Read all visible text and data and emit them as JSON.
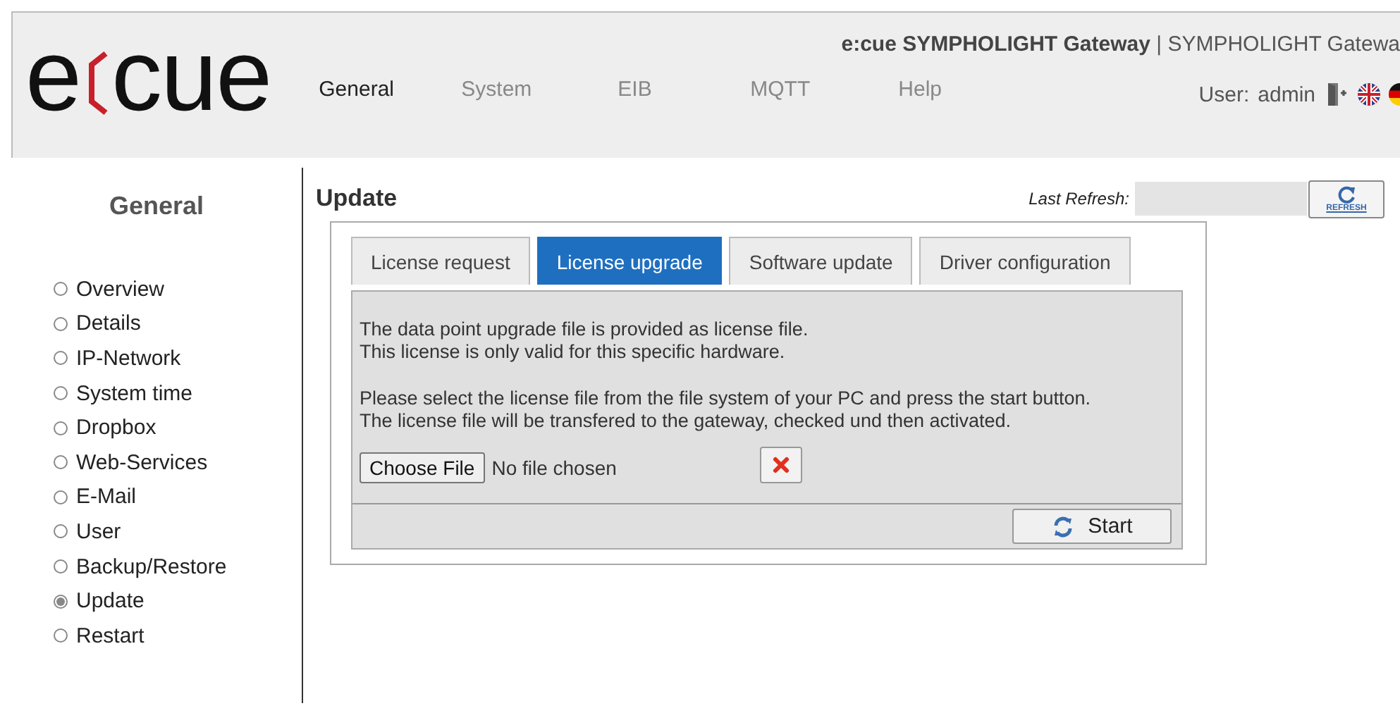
{
  "header": {
    "logo_left": "e",
    "logo_right": "cue",
    "product_bold": "e:cue SYMPHOLIGHT Gateway",
    "product_separator": "|",
    "product_name": "SYMPHOLIGHT Gatewa",
    "nav": [
      {
        "label": "General",
        "selected": true
      },
      {
        "label": "System",
        "selected": false
      },
      {
        "label": "EIB",
        "selected": false
      },
      {
        "label": "MQTT",
        "selected": false
      },
      {
        "label": "Help",
        "selected": false
      }
    ],
    "user_label": "User:",
    "user_name": "admin"
  },
  "sidebar": {
    "title": "General",
    "items": [
      {
        "label": "Overview",
        "selected": false
      },
      {
        "label": "Details",
        "selected": false
      },
      {
        "label": "IP-Network",
        "selected": false
      },
      {
        "label": "System time",
        "selected": false
      },
      {
        "label": "Dropbox",
        "selected": false
      },
      {
        "label": "Web-Services",
        "selected": false
      },
      {
        "label": "E-Mail",
        "selected": false
      },
      {
        "label": "User",
        "selected": false
      },
      {
        "label": "Backup/Restore",
        "selected": false
      },
      {
        "label": "Update",
        "selected": true
      },
      {
        "label": "Restart",
        "selected": false
      }
    ]
  },
  "main": {
    "title": "Update",
    "last_refresh_label": "Last Refresh:",
    "refresh_button": "REFRESH",
    "tabs": [
      {
        "label": "License request",
        "selected": false
      },
      {
        "label": "License upgrade",
        "selected": true
      },
      {
        "label": "Software update",
        "selected": false
      },
      {
        "label": "Driver configuration",
        "selected": false
      }
    ],
    "paragraphs": [
      [
        "The data point upgrade file is provided as license file.",
        "This license is only valid for this specific hardware."
      ],
      [
        "Please select the license file from the file system of your PC and press the start button.",
        "The license file will be transfered to the gateway, checked und then activated."
      ]
    ],
    "file_button": "Choose File",
    "file_status": "No file chosen",
    "start_button": "Start"
  }
}
